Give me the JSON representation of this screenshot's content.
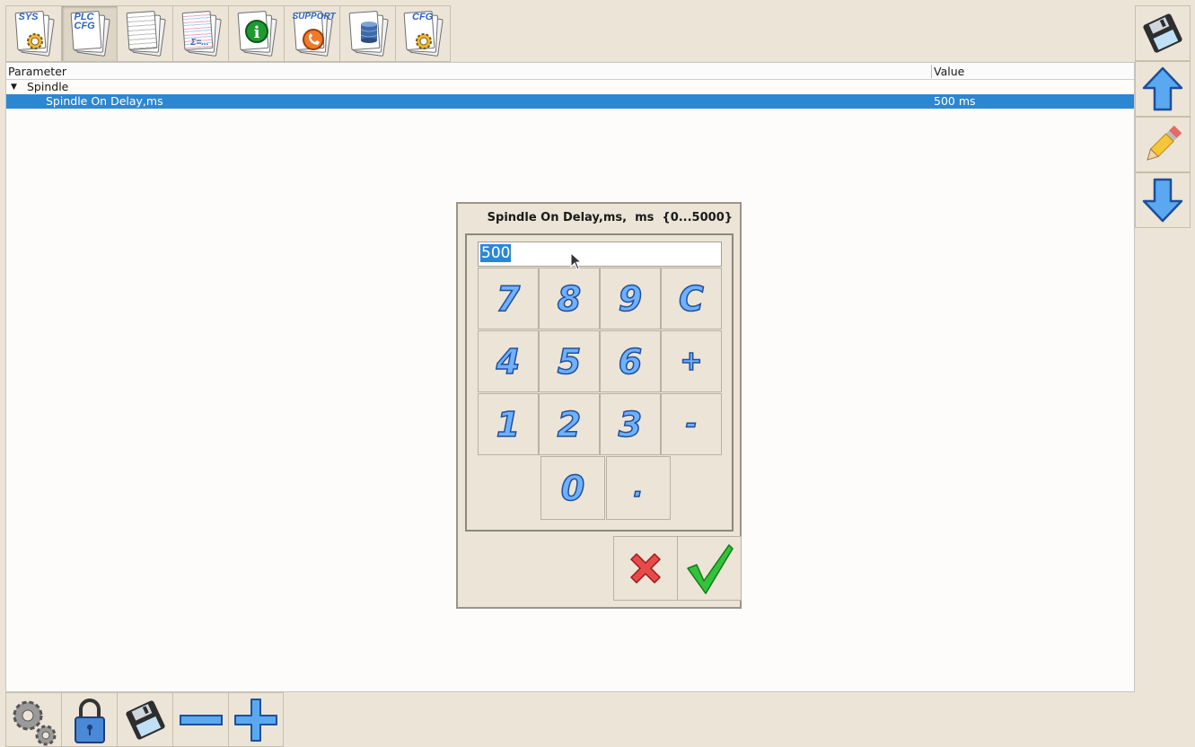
{
  "toolbar": {
    "tabs": [
      {
        "label": "SYS",
        "icon": "gear-icon"
      },
      {
        "label": "PLC CFG",
        "icon": "document-icon"
      },
      {
        "label": "",
        "icon": "document-icon"
      },
      {
        "label": "Σ=...",
        "icon": "formula-document-icon"
      },
      {
        "label": "i",
        "icon": "info-icon"
      },
      {
        "label": "SUPPORT",
        "icon": "phone-icon"
      },
      {
        "label": "",
        "icon": "database-icon"
      },
      {
        "label": "CFG",
        "icon": "gear-icon"
      }
    ]
  },
  "table": {
    "headers": {
      "parameter": "Parameter",
      "value": "Value"
    },
    "group": "Spindle",
    "rows": [
      {
        "parameter": "Spindle On Delay,ms",
        "value": "500 ms"
      }
    ]
  },
  "dialog": {
    "title": "Spindle On Delay,ms,  ms  {0...5000}",
    "input_value": "500",
    "keys": [
      "7",
      "8",
      "9",
      "C",
      "4",
      "5",
      "6",
      "+",
      "1",
      "2",
      "3",
      "-",
      "0",
      "."
    ]
  },
  "colors": {
    "background": "#ece4d6",
    "selection": "#2c87d3",
    "key_fill": "#6fb0ff"
  }
}
